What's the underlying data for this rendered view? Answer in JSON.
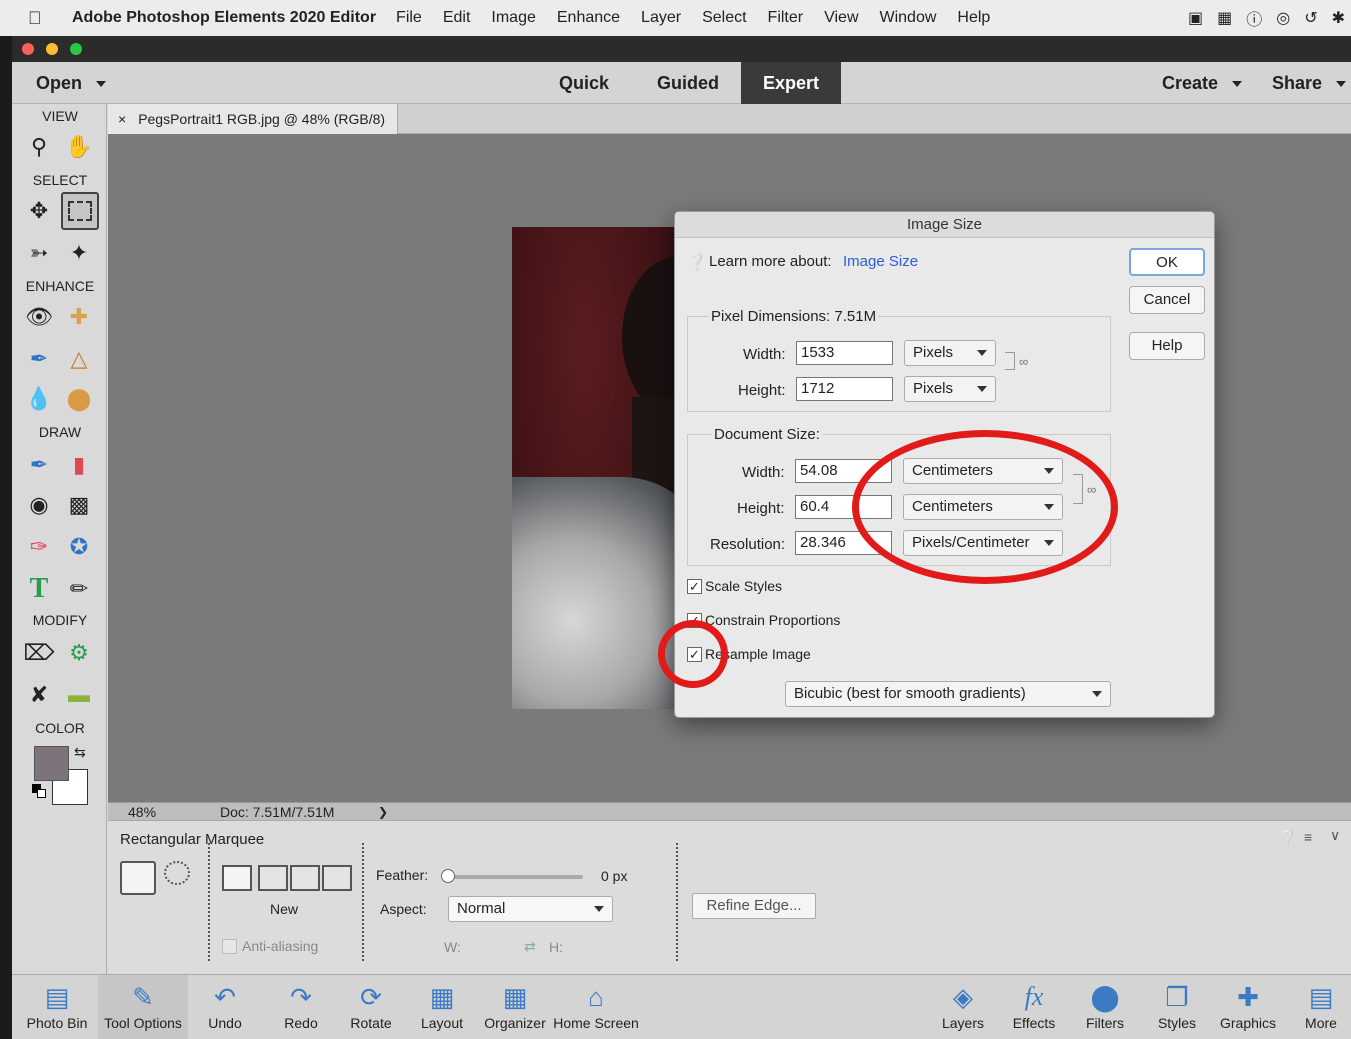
{
  "menubar": {
    "app_name": "Adobe Photoshop Elements 2020 Editor",
    "items": [
      "File",
      "Edit",
      "Image",
      "Enhance",
      "Layer",
      "Select",
      "Filter",
      "View",
      "Window",
      "Help"
    ]
  },
  "topbar": {
    "open_label": "Open",
    "modes": [
      "Quick",
      "Guided",
      "Expert"
    ],
    "active_mode": "Expert",
    "create_label": "Create",
    "share_label": "Share"
  },
  "toolbar": {
    "sections": [
      "VIEW",
      "SELECT",
      "ENHANCE",
      "DRAW",
      "MODIFY",
      "COLOR"
    ]
  },
  "document": {
    "tab_title": "PegsPortrait1 RGB.jpg @ 48% (RGB/8)",
    "zoom": "48%",
    "doc_info": "Doc: 7.51M/7.51M"
  },
  "tool_options": {
    "tool_name": "Rectangular Marquee",
    "new_label": "New",
    "anti_alias_label": "Anti-aliasing",
    "feather_label": "Feather:",
    "feather_value": "0 px",
    "aspect_label": "Aspect:",
    "aspect_value": "Normal",
    "w_label": "W:",
    "h_label": "H:",
    "refine_edge_label": "Refine Edge..."
  },
  "taskbar": {
    "left": [
      "Photo Bin",
      "Tool Options",
      "Undo",
      "Redo",
      "Rotate",
      "Layout",
      "Organizer",
      "Home Screen"
    ],
    "right": [
      "Layers",
      "Effects",
      "Filters",
      "Styles",
      "Graphics",
      "More"
    ]
  },
  "dialog": {
    "title": "Image Size",
    "learn_more_label": "Learn more about:",
    "learn_more_link": "Image Size",
    "ok_label": "OK",
    "cancel_label": "Cancel",
    "help_label": "Help",
    "pixel_dimensions_label": "Pixel Dimensions:",
    "pixel_dimensions_value": "7.51M",
    "px_width_label": "Width:",
    "px_width_value": "1533",
    "px_width_unit": "Pixels",
    "px_height_label": "Height:",
    "px_height_value": "1712",
    "px_height_unit": "Pixels",
    "document_size_label": "Document Size:",
    "doc_width_label": "Width:",
    "doc_width_value": "54.08",
    "doc_width_unit": "Centimeters",
    "doc_height_label": "Height:",
    "doc_height_value": "60.4",
    "doc_height_unit": "Centimeters",
    "resolution_label": "Resolution:",
    "resolution_value": "28.346",
    "resolution_unit": "Pixels/Centimeter",
    "scale_styles_label": "Scale Styles",
    "constrain_label": "Constrain Proportions",
    "resample_label": "Resample Image",
    "resample_method": "Bicubic (best for smooth gradients)"
  },
  "colors": {
    "annotation_red": "#e11a1a",
    "link_blue": "#2a5ce0",
    "foreground_swatch": "#7d747b"
  }
}
